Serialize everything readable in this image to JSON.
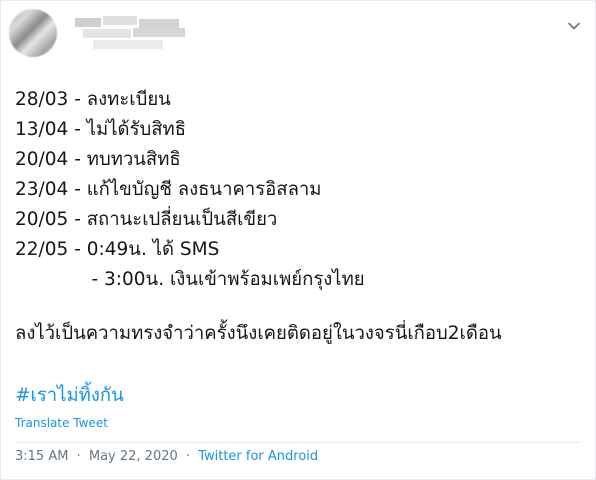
{
  "tweet": {
    "lines": [
      "28/03 - ลงทะเบียน",
      "13/04 - ไม่ได้รับสิทธิ",
      "20/04 - ทบทวนสิทธิ",
      "23/04 - แก้ไขบัญชี ลงธนาคารอิสลาม",
      "20/05 - สถานะเปลี่ยนเป็นสีเขียว",
      "22/05 - 0:49น. ได้ SMS",
      "             - 3:00น. เงินเข้าพร้อมเพย์กรุงไทย"
    ],
    "note": "ลงไว้เป็นความทรงจำว่าครั้งนึงเคยติดอยู่ในวงจรนี่เกือบ2เดือน",
    "hashtag": "#เราไม่ทิ้งกัน",
    "translate_label": "Translate Tweet",
    "time": "3:15 AM",
    "separator": "·",
    "date": "May 22, 2020",
    "client": "Twitter for Android"
  },
  "icons": {
    "menu": "chevron-down-icon"
  },
  "colors": {
    "link": "#1b95e0",
    "meta": "#657786",
    "text": "#14171a"
  }
}
